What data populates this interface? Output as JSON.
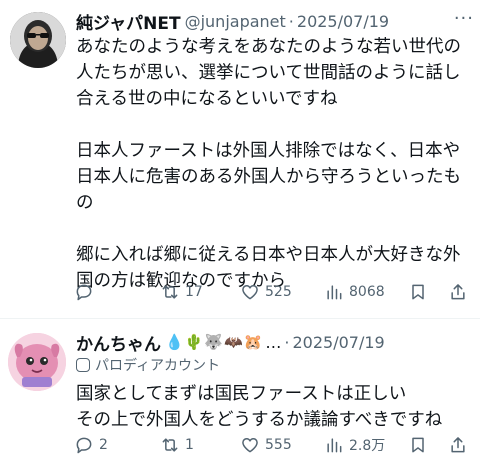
{
  "tweets": [
    {
      "name": "純ジャパNET",
      "handle": "@junjapanet",
      "separator": "·",
      "date": "2025/07/19",
      "more": "···",
      "body": "あなたのような考えをあなたのような若い世代の\n人たちが思い、選挙について世間話のように話し\n合える世の中になるといいですね\n\n日本人ファーストは外国人排除ではなく、日本や\n日本人に危害のある外国人から守ろうといったも\nの\n\n郷に入れば郷に従える日本や日本人が大好きな外\n国の方は歓迎なのですから",
      "actions": {
        "replies": "",
        "reposts": "17",
        "likes": "525",
        "views": "8068"
      }
    },
    {
      "name": "かんちゃん",
      "emojis": "💧🌵🐺🦇🐹",
      "ellipsis": "…",
      "separator": "·",
      "date": "2025/07/19",
      "parody_label": "パロディアカウント",
      "body": "国家としてまずは国民ファーストは正しい\nその上で外国人をどうするか議論すべきですね",
      "actions": {
        "replies": "2",
        "reposts": "1",
        "likes": "555",
        "views": "2.8万"
      }
    }
  ],
  "icons": {
    "reply": "reply-icon",
    "repost": "repost-icon",
    "like": "heart-icon",
    "views": "views-icon",
    "bookmark": "bookmark-icon",
    "share": "share-icon"
  },
  "colors": {
    "text": "#0f1419",
    "secondary": "#536471",
    "divider": "#eff3f4"
  }
}
